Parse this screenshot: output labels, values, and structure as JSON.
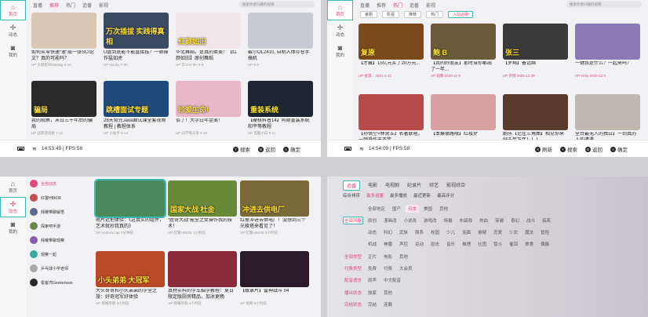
{
  "nav": [
    {
      "label": "首页",
      "icon": "⌂"
    },
    {
      "label": "动态",
      "icon": "✢"
    },
    {
      "label": "我的",
      "icon": "◙"
    }
  ],
  "tabs_top": [
    "直播",
    "推荐",
    "热门",
    "追番",
    "影视"
  ],
  "search_placeholder": "搜索你感兴趣的视频",
  "p1": {
    "cards": [
      {
        "title": "如何从零快速“速”出一张SCI论文？真的可能吗？",
        "sub": "UP 文献指导Data&g 6-19",
        "thumb_text": "",
        "color": "#d9c8b4"
      },
      {
        "title": "U盘到底能不能直接拔？一顿操作猛如虎",
        "sub": "UP epcdiy 7-30",
        "thumb_text": "万次插拔 实践得真相",
        "color": "#3b4a63"
      },
      {
        "title": "华北舞蹈。是真的柔美！【红颜如旧】原创舞蹈",
        "sub": "UP 华-DO-fes 8-5",
        "thumb_text": "红颜如旧",
        "color": "#f2e6ea"
      },
      {
        "title": "戴尔OL2410, 自制入体存仓手搞机",
        "sub": "UP 8-8",
        "thumb_text": "",
        "color": "#c7cbd2"
      },
      {
        "title": "我的观察，未日三十年后的骗局",
        "sub": "UP 国家话语教 7-12",
        "thumb_text": "骗局",
        "color": "#2a2a2a"
      },
      {
        "title": "28天背完Java面试课全套视频教程 | 教程体系",
        "sub": "UP 小助手 8-14",
        "thumb_text": "跳槽面试专题",
        "color": "#1f4a7a"
      },
      {
        "title": "佰了！大学白年金美！",
        "sub": "UP 同学每天发 8-16",
        "thumb_text": "珍爱生命!",
        "color": "#e8b8c8"
      },
      {
        "title": "【硬核科普14】阿斯重装系统和平等教程",
        "sub": "UP 电脑小白 8-11",
        "thumb_text": "重装系统",
        "color": "#1d2733"
      }
    ],
    "time": "14:53:49 | FPS:58",
    "hints": [
      {
        "k": "Y",
        "t": "搜索"
      },
      {
        "k": "B",
        "t": "返回"
      },
      {
        "k": "A",
        "t": "确定"
      }
    ]
  },
  "p2": {
    "subtabs": [
      "番剧",
      "影视",
      "推荐",
      "热门"
    ],
    "sel_tab": "入站必刷",
    "cards": [
      {
        "title": "【才藏】15亿元买了20万元...",
        "sub": "UP 拾遗... 2021-4-12",
        "thumb_text": "复原",
        "color": "#7a4a1a"
      },
      {
        "title": "【我的好朋友】那时当你都出了一年...",
        "sub": "UP 观察 2020-11-9",
        "thumb_text": "鲍 B",
        "color": "#6a5a3a"
      },
      {
        "title": "【罗翔】备话绵",
        "sub": "UP 罗翔 2020-12-28",
        "thumb_text": "张三",
        "color": "#3a3a3a"
      },
      {
        "title": "一键我是什么？一起来吗？",
        "sub": "UP vicky 2020-12-3",
        "thumb_text": "",
        "color": "#8a7ab8"
      },
      {
        "title": "【孙悟空×林黛玉】名著联唱，一顿操作无不笑",
        "sub": "UP 2021-2-8",
        "thumb_text": "",
        "color": "#b84a4a"
      },
      {
        "title": "【本桑德路哦】红楼梦",
        "sub": "UP 2020-8-12",
        "thumb_text": "",
        "color": "#d8a0a0"
      },
      {
        "title": "朝乐【范佳三角曲】相见你来好千年万年！！！",
        "sub": "UP 2020-5-23",
        "thumb_text": "",
        "color": "#5a3a2a"
      },
      {
        "title": "全台最无人的独白】一到真的人的遭遇",
        "sub": "UP 2021-7-19",
        "thumb_text": "",
        "color": "#c0b8b0"
      }
    ],
    "time": "14:54:09 | FPS:58",
    "hints": [
      {
        "k": "X",
        "t": "刷新"
      },
      {
        "k": "Y",
        "t": "搜索"
      },
      {
        "k": "B",
        "t": "返回"
      },
      {
        "k": "A",
        "t": "确定"
      }
    ]
  },
  "p3": {
    "users": [
      {
        "name": "全部动态",
        "color": "#e0457b"
      },
      {
        "name": "红警HBK08",
        "color": "#c05050"
      },
      {
        "name": "拜耀带聊解悟",
        "color": "#5a6a8a"
      },
      {
        "name": "探索吧手游",
        "color": "#6a8a4a"
      },
      {
        "name": "拜耀带聊观察",
        "color": "#8a5aa8"
      },
      {
        "name": "观察一起",
        "color": "#3aa8a0"
      },
      {
        "name": "乒乓球小学老师",
        "color": "#a8a8a8"
      },
      {
        "name": "极客湾Geekerwan",
        "color": "#2a2a2a"
      }
    ],
    "cards": [
      {
        "title": "嗯片近把体验：《这真实的组件，艺术就抄我真的》",
        "sub": "UP AndrewCap 3分钟前",
        "thumb_text": "",
        "color": "#4a8a5a",
        "sel": true
      },
      {
        "title": "“胜哥大战”能全之女操作我的技术！",
        "sub": "UP 红警HBK08 1小时前",
        "thumb_text": "国家大战 杜金",
        "color": "#6a8a3a"
      },
      {
        "title": "红警冲进去供电厂！没想到三个光棱塔来看见了！",
        "sub": "UP 红警HBK08 4小时前",
        "thumb_text": "冲进去供电厂",
        "color": "#7a6a3a"
      },
      {
        "title": "大头哥哥和小头弟弟的学堂之旅：好奇冠军好体验",
        "sub": "UP 拜耀带聊 3小时前",
        "thumb_text": "小头弟弟 大冠军",
        "color": "#b84a2a"
      },
      {
        "title": "真材实料的学车脑学教程：夏日限定版厨房精品，加冰更畅",
        "sub": "UP 拜耀带聊 4小时前",
        "thumb_text": "",
        "color": "#8a2a3a"
      },
      {
        "title": "【敬录片】雷神战斗 04",
        "sub": "UP 观察 8小时前",
        "thumb_text": "",
        "color": "#2a1a2a"
      }
    ]
  },
  "p4": {
    "cats": [
      "追番",
      "电影",
      "电视剧",
      "纪录片",
      "综艺",
      "影视综合"
    ],
    "sorts": [
      "综合排序",
      "最多追番",
      "最多播放",
      "最近更新",
      "最高评分"
    ],
    "rows": [
      {
        "key": "",
        "vals": [
          "全部地区",
          "国产",
          "日本",
          "美国",
          "其他"
        ],
        "sel": 2
      },
      {
        "key": "全部风格",
        "vals": [
          "原创",
          "漫画改",
          "小说改",
          "游戏改",
          "特摄",
          "布袋戏",
          "热血",
          "穿越",
          "奇幻",
          "战斗",
          "搞笑"
        ],
        "sel": -1
      },
      {
        "key": "",
        "vals": [
          "动态",
          "科幻",
          "武侠",
          "萌系",
          "校园",
          "少儿",
          "泡面",
          "悬疑",
          "恋爱",
          "少女",
          "魔法",
          "冒险"
        ],
        "sel": -1
      },
      {
        "key": "",
        "vals": [
          "机战",
          "神魔",
          "声控",
          "运动",
          "励志",
          "音乐",
          "推理",
          "社团",
          "智斗",
          "催泪",
          "美食",
          "偶像"
        ],
        "sel": -1
      },
      {
        "key": "全部类型",
        "vals": [
          "正片",
          "电影",
          "其他"
        ],
        "sel": -1
      },
      {
        "key": "付费类型",
        "vals": [
          "免费",
          "付费",
          "大会员"
        ],
        "sel": -1
      },
      {
        "key": "配音语言",
        "vals": [
          "原声",
          "中文配音"
        ],
        "sel": -1
      },
      {
        "key": "播出状态",
        "vals": [
          "独家",
          "其他"
        ],
        "sel": -1
      },
      {
        "key": "完结状态",
        "vals": [
          "完结",
          "连载"
        ],
        "sel": -1
      }
    ],
    "filter_tag": "全部风格"
  },
  "colors": {
    "accent": "#e0457b",
    "focus": "#3cb8b4"
  }
}
